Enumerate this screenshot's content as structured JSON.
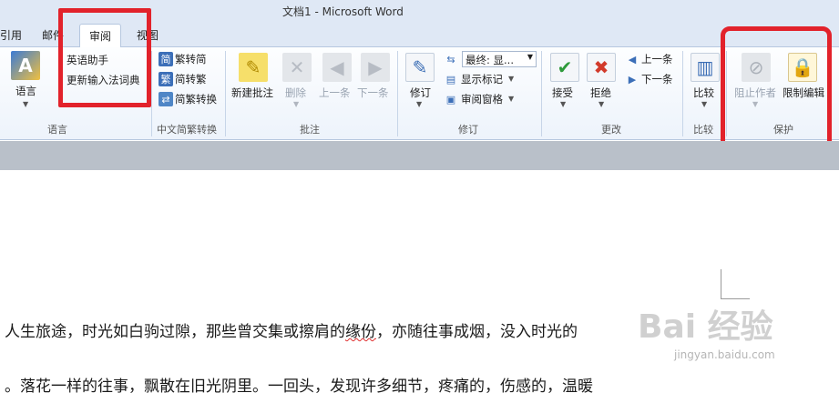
{
  "window": {
    "title": "文档1  -  Microsoft Word"
  },
  "tabs": [
    {
      "label": "引用"
    },
    {
      "label": "邮件"
    },
    {
      "label": "审阅",
      "active": true
    },
    {
      "label": "视图"
    }
  ],
  "groups": {
    "language": {
      "label": "语言",
      "buttons": {
        "language": "语言",
        "english_assistant": "英语助手",
        "update_ime_dict": "更新输入法词典"
      }
    },
    "chinese_conversion": {
      "label": "中文简繁转换",
      "buttons": {
        "to_simplified_glyph": "简",
        "to_simplified": "繁转简",
        "to_traditional_glyph": "繁",
        "to_traditional": "简转繁",
        "convert": "简繁转换"
      }
    },
    "comments": {
      "label": "批注",
      "buttons": {
        "new_comment": "新建批注",
        "delete": "删除",
        "previous": "上一条",
        "next": "下一条"
      }
    },
    "tracking": {
      "label": "修订",
      "buttons": {
        "track_changes": "修订",
        "display_mode": "最终: 显...",
        "show_markup": "显示标记",
        "reviewing_pane": "审阅窗格"
      }
    },
    "changes": {
      "label": "更改",
      "buttons": {
        "accept": "接受",
        "reject": "拒绝",
        "previous": "上一条",
        "next": "下一条"
      }
    },
    "compare": {
      "label": "比较",
      "buttons": {
        "compare": "比较"
      }
    },
    "protect": {
      "label": "保护",
      "buttons": {
        "block_authors": "阻止作者",
        "restrict_editing": "限制编辑"
      }
    }
  },
  "document": {
    "line1_before": "人生旅途，时光如白驹过隙，那些曾交集或擦肩的",
    "line1_wavy": "缘份",
    "line1_after": "，亦随往事成烟，没入时光的",
    "line2": "。落花一样的往事，飘散在旧光阴里。一回头，发现许多细节，疼痛的，伤感的，温暖"
  },
  "watermark": {
    "main": "Bai 经验",
    "sub": "jingyan.baidu.com"
  },
  "colors": {
    "annotation_red": "#e2222b",
    "ribbon_bg": "#dfe8f5"
  }
}
